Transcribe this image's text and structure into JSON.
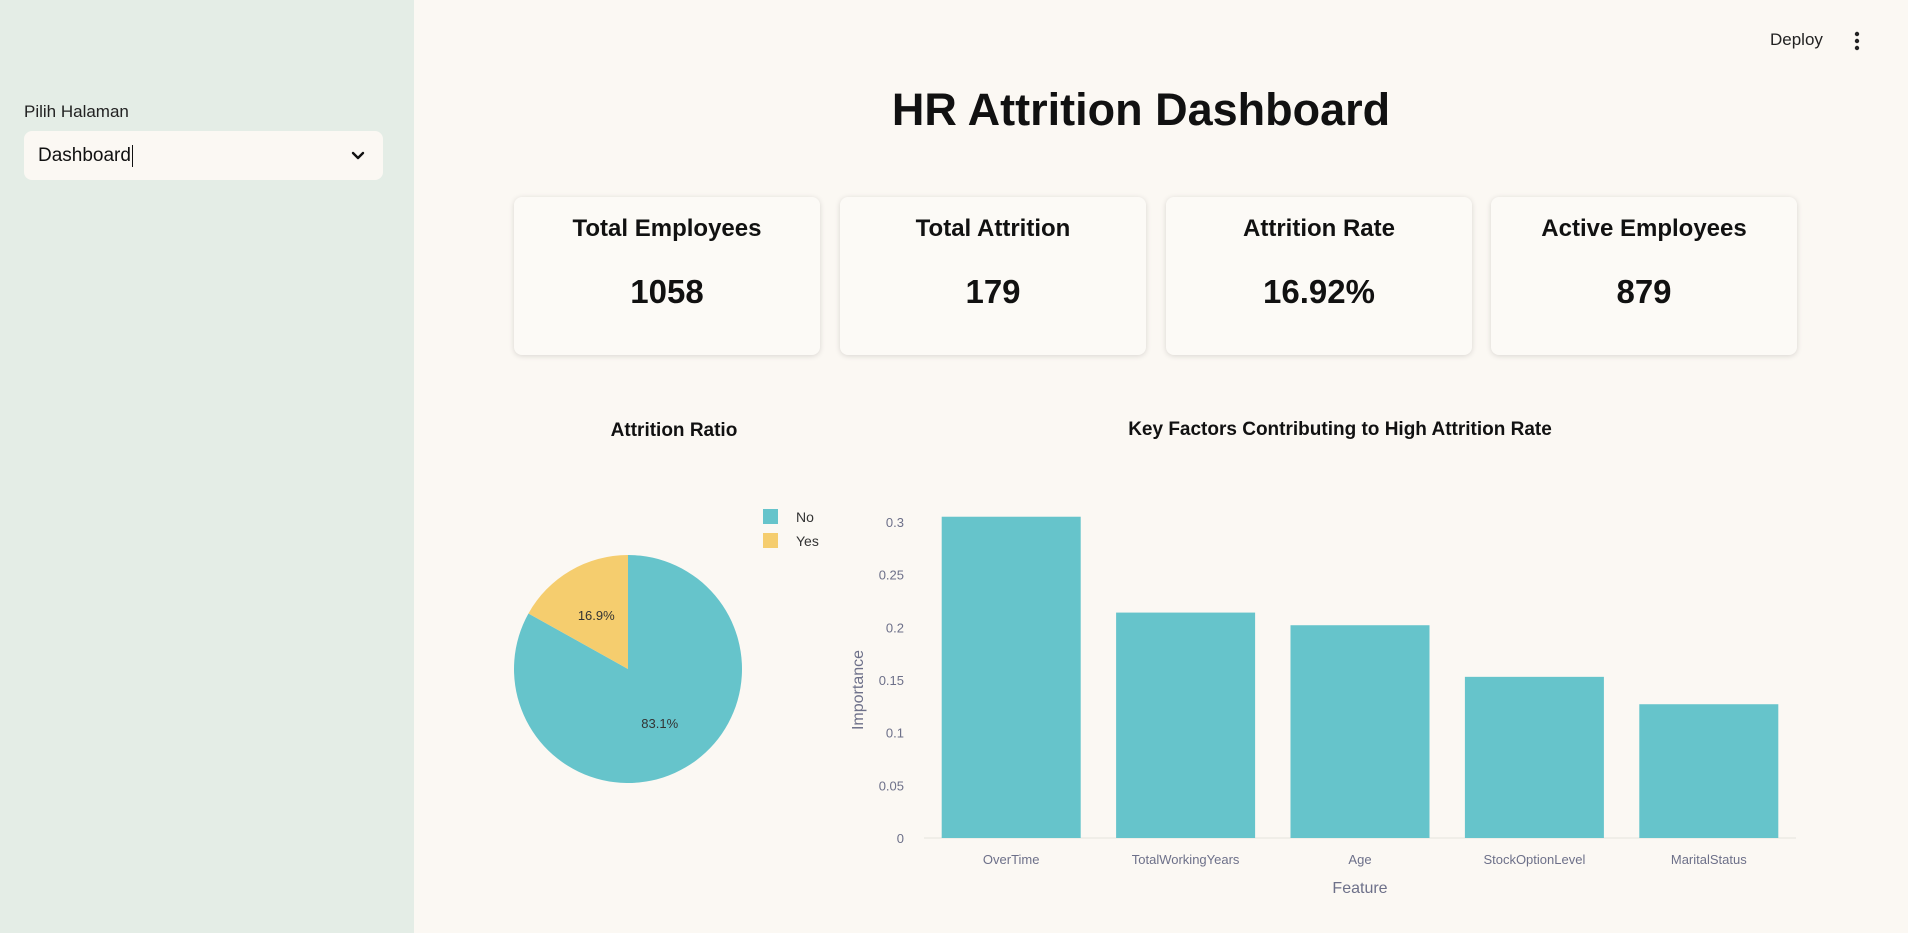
{
  "sidebar": {
    "label": "Pilih Halaman",
    "select_value": "Dashboard",
    "chevron_icon": "chevron-down-icon"
  },
  "toolbar": {
    "deploy_label": "Deploy",
    "menu_icon": "vertical-ellipsis-icon"
  },
  "page_title": "HR Attrition Dashboard",
  "metrics": [
    {
      "label": "Total Employees",
      "value": "1058"
    },
    {
      "label": "Total Attrition",
      "value": "179"
    },
    {
      "label": "Attrition Rate",
      "value": "16.92%"
    },
    {
      "label": "Active Employees",
      "value": "879"
    }
  ],
  "colors": {
    "teal": "#66c4cb",
    "yellow": "#f5cd6e",
    "sidebar_bg": "#e4ede6",
    "page_bg": "#fbf8f3"
  },
  "chart_data": [
    {
      "type": "pie",
      "title": "Attrition Ratio",
      "labels": [
        "No",
        "Yes"
      ],
      "values": [
        83.1,
        16.9
      ],
      "data_labels": [
        "83.1%",
        "16.9%"
      ],
      "legend": "top-right"
    },
    {
      "type": "bar",
      "title": "Key Factors Contributing to High Attrition Rate",
      "xlabel": "Feature",
      "ylabel": "Importance",
      "categories": [
        "OverTime",
        "TotalWorkingYears",
        "Age",
        "StockOptionLevel",
        "MaritalStatus"
      ],
      "values": [
        0.305,
        0.214,
        0.202,
        0.153,
        0.127
      ],
      "ylim": [
        0,
        0.31
      ],
      "yticks": [
        "0",
        "0.05",
        "0.1",
        "0.15",
        "0.2",
        "0.25",
        "0.3"
      ],
      "grid": false
    }
  ]
}
